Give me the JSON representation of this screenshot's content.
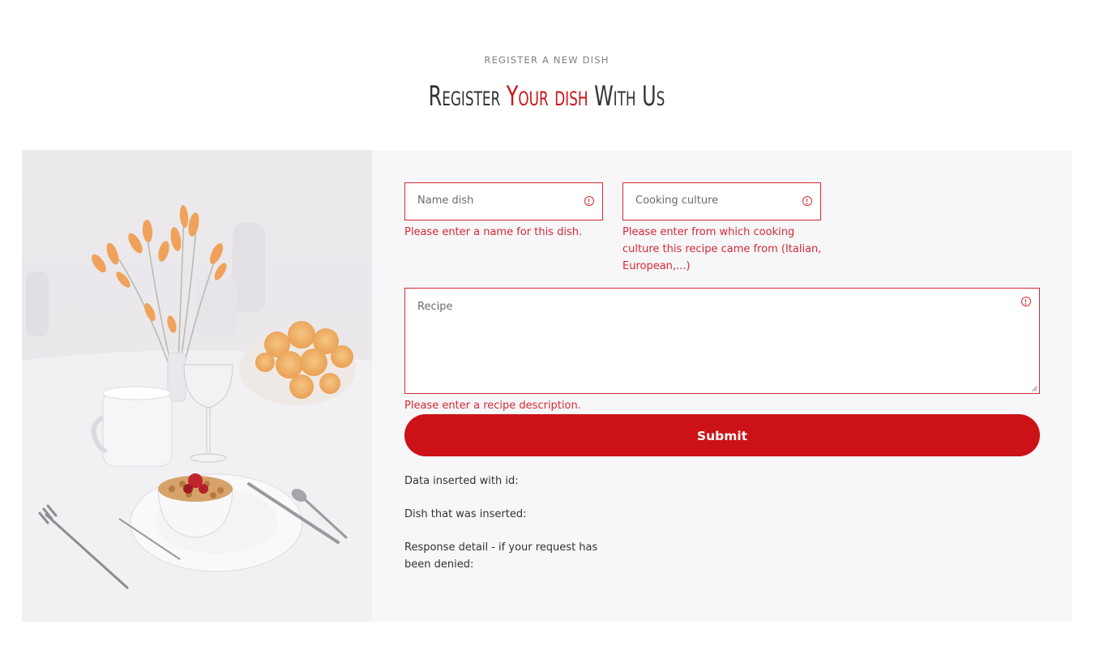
{
  "header": {
    "eyebrow": "REGISTER A NEW DISH",
    "title_prefix": "Register ",
    "title_accent": "Your dish",
    "title_suffix": " With Us"
  },
  "colors": {
    "accent": "#cc1216",
    "error": "#d42a35",
    "panel_bg": "#f7f6f9"
  },
  "photo": {
    "description_icon": "table-setting-photo"
  },
  "form": {
    "name_dish": {
      "placeholder": "Name dish",
      "error": "Please enter a name for this dish."
    },
    "cooking_culture": {
      "placeholder": "Cooking culture",
      "error_line1": "Please enter from which cooking",
      "error_line2": "culture this recipe came from (Italian,",
      "error_line3": "European,...)"
    },
    "recipe": {
      "placeholder": "Recipe",
      "error": "Please enter a recipe description."
    },
    "submit_label": "Submit"
  },
  "results": {
    "inserted_id_label": "Data inserted with id:",
    "dish_inserted_label": "Dish that was inserted:",
    "response_detail_line1": "Response detail - if your request has",
    "response_detail_line2": "been denied:"
  }
}
